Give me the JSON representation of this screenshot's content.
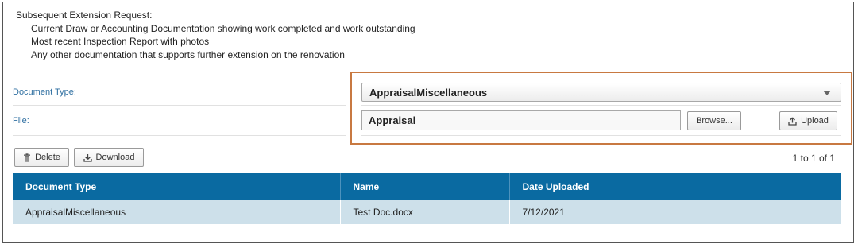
{
  "instructions": {
    "heading": "Subsequent Extension Request:",
    "items": [
      "Current Draw or Accounting Documentation showing work completed and work outstanding",
      "Most recent Inspection Report with photos",
      "Any other documentation that supports further extension on the renovation"
    ]
  },
  "form": {
    "document_type_label": "Document Type:",
    "document_type_value": "AppraisalMiscellaneous",
    "file_label": "File:",
    "file_value": "Appraisal",
    "browse_label": "Browse...",
    "upload_label": "Upload"
  },
  "toolbar": {
    "delete_label": "Delete",
    "download_label": "Download",
    "pager_text": "1 to 1 of 1"
  },
  "table": {
    "columns": [
      "Document Type",
      "Name",
      "Date Uploaded"
    ],
    "rows": [
      [
        "AppraisalMiscellaneous",
        "Test Doc.docx",
        "7/12/2021"
      ]
    ]
  },
  "colors": {
    "header_bg": "#0a6aa1",
    "row_bg": "#cde0ea",
    "label_blue": "#2d6ea0",
    "highlight_border": "#c87941"
  },
  "icons": [
    "trash-icon",
    "download-icon",
    "upload-icon",
    "dropdown-arrow-icon"
  ]
}
